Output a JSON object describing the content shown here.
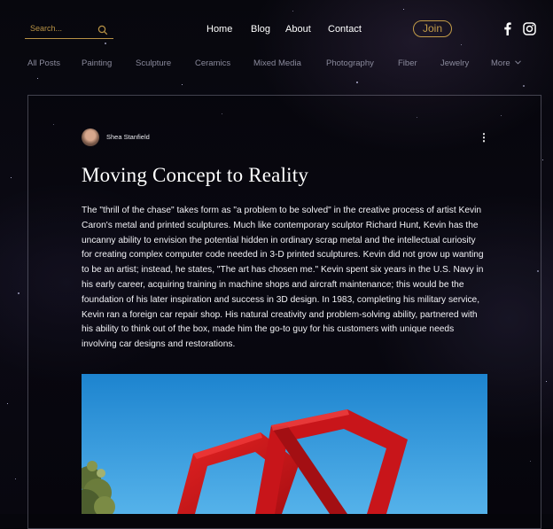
{
  "header": {
    "search": {
      "placeholder": "Search...",
      "icon": "search-icon"
    },
    "nav": [
      "Home",
      "Blog",
      "About",
      "Contact"
    ],
    "join_label": "Join",
    "social": [
      "facebook-icon",
      "instagram-icon"
    ]
  },
  "categories": [
    "All Posts",
    "Painting",
    "Sculpture",
    "Ceramics",
    "Mixed Media",
    "Photography",
    "Fiber",
    "Jewelry",
    "More"
  ],
  "post": {
    "author": "Shea Stanfield",
    "title": "Moving Concept to Reality",
    "body": "The \"thrill of the chase\" takes form as \"a problem to be solved\" in the creative process of artist Kevin Caron's metal and printed sculptures. Much like contemporary sculptor Richard Hunt, Kevin has the uncanny ability to envision the potential hidden in ordinary scrap metal and the intellectual curiosity for creating complex computer code needed in 3-D printed sculptures. Kevin did not grow up wanting to be an artist; instead, he states, \"The art has chosen me.\" Kevin spent six years in the U.S. Navy in his early career, acquiring training in machine shops and aircraft maintenance; this would be the foundation of his later inspiration and success in 3D design. In 1983, completing his military service, Kevin ran a foreign car repair shop. His natural creativity and problem-solving ability, partnered with his ability to think out of the box, made him the go-to guy for his customers with unique needs involving car designs and restorations."
  },
  "colors": {
    "accent_gold": "#c29b48",
    "background": "#06060c",
    "text": "#ffffff",
    "category_text": "#8a8a9c",
    "sculpture_red": "#d01818",
    "sky_blue": "#2a93db"
  }
}
